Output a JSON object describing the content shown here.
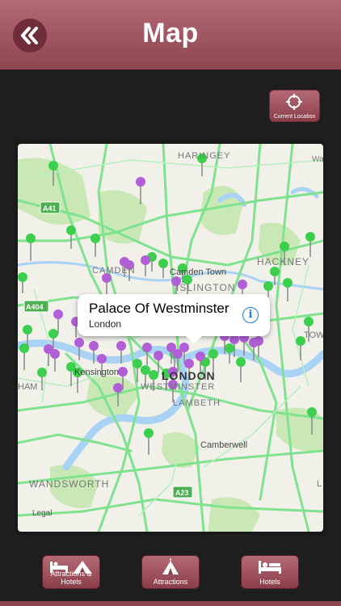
{
  "header": {
    "title": "Map",
    "back_icon": "double-chevron-left-icon"
  },
  "current_location_button": {
    "label": "Current Location",
    "icon": "crosshair-icon"
  },
  "map": {
    "labels": [
      "HARINGEY",
      "Wa",
      "A41",
      "CAMDEN",
      "Camden Town",
      "HACKNEY",
      "A404",
      "ISLINGTON",
      "Kensington",
      "LONDON",
      "WESTMINSTER",
      "LAMBETH",
      "Camberwell",
      "HAM",
      "WANDSWORTH",
      "A23",
      "Legal",
      "TOW",
      "L"
    ],
    "callout": {
      "title": "Palace Of Westminster",
      "subtitle": "London",
      "info_icon": "info-icon"
    },
    "colors": {
      "green_pin": "#3ccf4e",
      "purple_pin": "#b15fd6",
      "water": "#a9d3f5",
      "road": "#7fe28f",
      "park": "#c9e8b5"
    }
  },
  "tabs": [
    {
      "label": "Attractions & Hotels",
      "icon": "bed-and-tent-icon"
    },
    {
      "label": "Attractions",
      "icon": "tent-icon"
    },
    {
      "label": "Hotels",
      "icon": "bed-icon"
    }
  ]
}
